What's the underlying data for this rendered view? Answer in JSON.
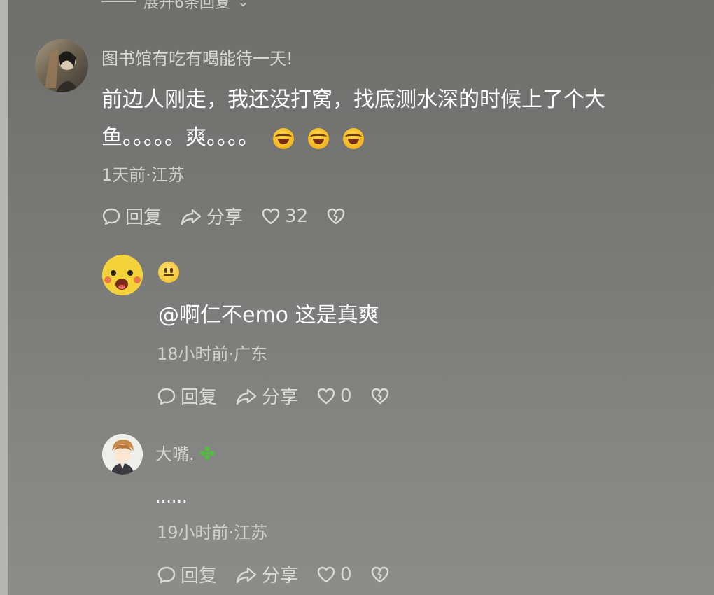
{
  "expand_text": "展开6条回复",
  "comments": [
    {
      "username": "图书馆有吃有喝能待一天!",
      "text_line1": "前边人刚走，我还没打窝，找底测水深的时候上了个大",
      "text_line2": "鱼。。。。。爽。。。。",
      "emoji_count": 3,
      "meta": "1天前·江苏",
      "reply_label": "回复",
      "share_label": "分享",
      "likes": "32"
    },
    {
      "username": "",
      "text": "@啊仁不emo  这是真爽",
      "meta": "18小时前·广东",
      "reply_label": "回复",
      "share_label": "分享",
      "likes": "0"
    },
    {
      "username": "大嘴.",
      "text": "......",
      "meta": "19小时前·江苏",
      "reply_label": "回复",
      "share_label": "分享",
      "likes": "0"
    }
  ]
}
